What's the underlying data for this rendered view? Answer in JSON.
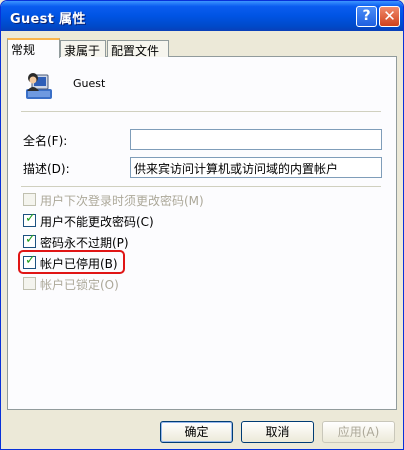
{
  "window": {
    "title": "Guest 属性"
  },
  "titlebar": {
    "help_label": "?",
    "close_label": "✕"
  },
  "tabs": [
    {
      "label": "常规"
    },
    {
      "label": "隶属于"
    },
    {
      "label": "配置文件"
    }
  ],
  "user": {
    "name": "Guest"
  },
  "fields": {
    "fullname": {
      "label": "全名(F):",
      "value": ""
    },
    "description": {
      "label": "描述(D):",
      "value": "供来宾访问计算机或访问域的内置帐户"
    }
  },
  "checkboxes": [
    {
      "label": "用户下次登录时须更改密码(M)",
      "checked": false,
      "disabled": true
    },
    {
      "label": "用户不能更改密码(C)",
      "checked": true,
      "disabled": false
    },
    {
      "label": "密码永不过期(P)",
      "checked": true,
      "disabled": false
    },
    {
      "label": "帐户已停用(B)",
      "checked": true,
      "disabled": false
    },
    {
      "label": "帐户已锁定(O)",
      "checked": false,
      "disabled": true
    }
  ],
  "buttons": {
    "ok": "确定",
    "cancel": "取消",
    "apply": "应用(A)"
  },
  "colors": {
    "titlebar": "#0054e3",
    "highlight_border": "#e01515",
    "checkmark": "#21a121"
  }
}
